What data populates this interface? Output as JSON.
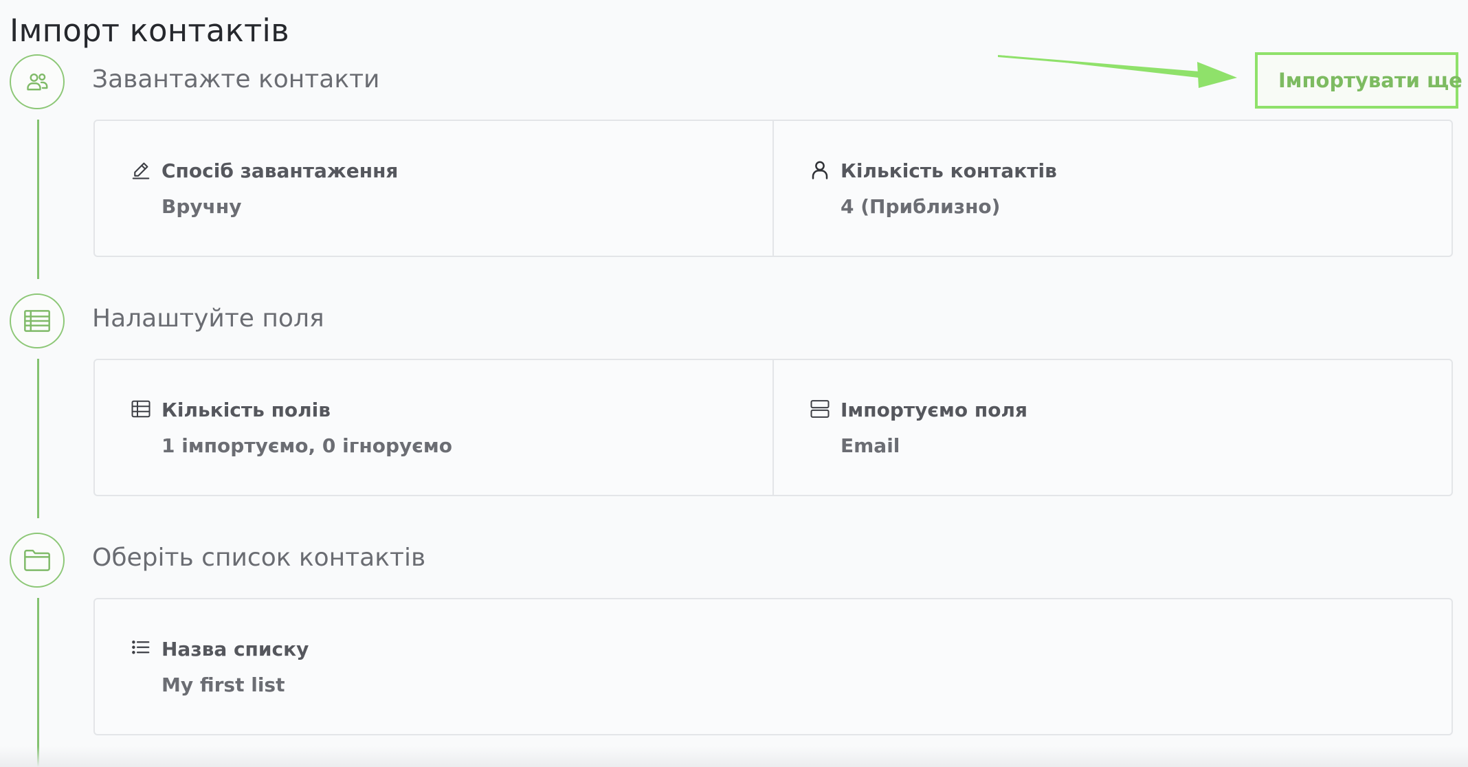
{
  "page": {
    "title": "Імпорт контактів"
  },
  "colors": {
    "accent": "#84c270",
    "highlight": "#8fe16a",
    "border": "#e3e5e8"
  },
  "import_more": {
    "label": "Імпортувати ще",
    "icon": "refresh-icon"
  },
  "steps": [
    {
      "title": "Завантажте контакти",
      "icon": "users-icon",
      "fields": [
        {
          "icon": "pencil-icon",
          "label": "Спосіб завантаження",
          "value": "Вручну"
        },
        {
          "icon": "user-icon",
          "label": "Кількість контактів",
          "value": "4 (Приблизно)"
        }
      ]
    },
    {
      "title": "Налаштуйте поля",
      "icon": "table-icon",
      "fields": [
        {
          "icon": "table-small-icon",
          "label": "Кількість полів",
          "value": "1 імпортуємо, 0 ігноруємо"
        },
        {
          "icon": "rows-icon",
          "label": "Імпортуємо поля",
          "value": "Email"
        }
      ]
    },
    {
      "title": "Оберіть список контактів",
      "icon": "folder-icon",
      "fields": [
        {
          "icon": "list-icon",
          "label": "Назва списку",
          "value": "My first list"
        }
      ]
    }
  ]
}
